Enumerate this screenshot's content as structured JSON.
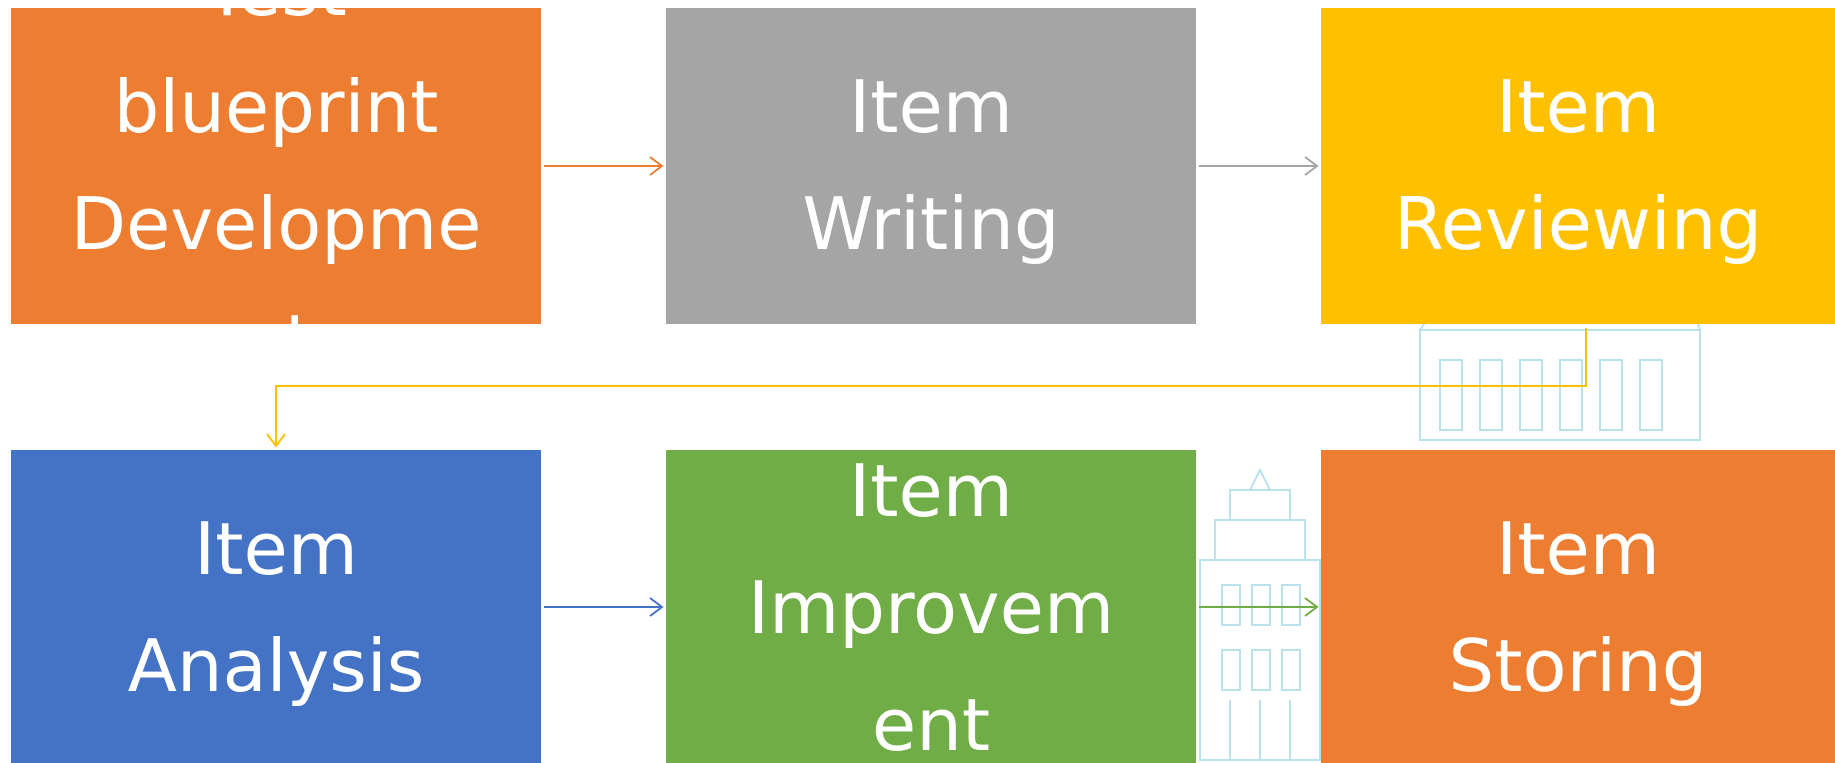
{
  "steps": [
    {
      "label": "Test\nblueprint\nDevelopme\nnt",
      "color": "#ED7D31"
    },
    {
      "label": "Item\nWriting",
      "color": "#A5A5A5"
    },
    {
      "label": "Item\nReviewing",
      "color": "#FFC000"
    },
    {
      "label": "Item\nAnalysis",
      "color": "#4472C4"
    },
    {
      "label": "Item\nImprovem\nent",
      "color": "#70AD47"
    },
    {
      "label": "Item\nStoring",
      "color": "#ED7D31"
    }
  ],
  "watermark_color": "#A9DCE8"
}
